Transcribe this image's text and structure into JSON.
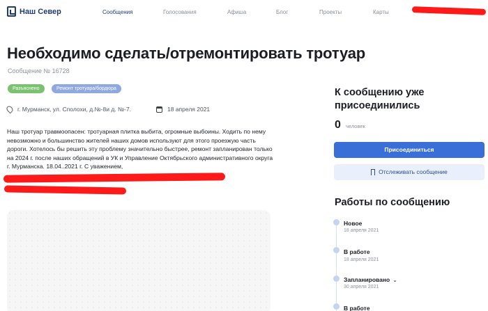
{
  "header": {
    "logo_text": "Наш Север",
    "nav": [
      {
        "label": "Сообщения",
        "active": true
      },
      {
        "label": "Голосования"
      },
      {
        "label": "Афиша"
      },
      {
        "label": "Блог"
      },
      {
        "label": "Проекты"
      },
      {
        "label": "Карты"
      }
    ]
  },
  "message": {
    "title": "Необходимо сделать/отремонтировать тротуар",
    "number": "Сообщение № 16728",
    "badges": [
      "Разъяснено",
      "Ремонт тротуара/бордюра"
    ],
    "address": "г. Мурманск, ул. Сполохи, д.№-8и д. №-7.",
    "date": "18 апреля 2021",
    "text": "Наш тротуар травмоопасен: тротуарная плитка выбита, огромные выбоины. Ходить по нему невозможно и большинство жителей наших домов используют для этого проезжую часть дороги. Хотелось бы решить эту проблему значительно быстрее, ремонт запланирован только на 2024 г. после наших обращений в УК и Управление Октябрьского административного округа г. Мурманска. 18.04..2021 г. С уважением,"
  },
  "sidebar": {
    "join_title": "К сообщению уже присоединились",
    "count": "0",
    "count_unit": "человек",
    "join_button": "Присоединиться",
    "track_button": "Отслеживать сообщение",
    "works_title": "Работы по сообщению",
    "timeline": [
      {
        "status": "Новое",
        "date": "18 апреля 2021"
      },
      {
        "status": "В работе",
        "date": "18 апреля 2021"
      },
      {
        "status": "Запланировано",
        "date": "30 апреля 2021",
        "expandable": true
      },
      {
        "status": "В работе",
        "date": ""
      }
    ]
  },
  "colors": {
    "brand": "#1f3b6f",
    "primary_button": "#3a6fd8",
    "badge_green": "#7ac26f",
    "badge_blue": "#8fa8e0",
    "redaction": "#ff1a1a"
  }
}
